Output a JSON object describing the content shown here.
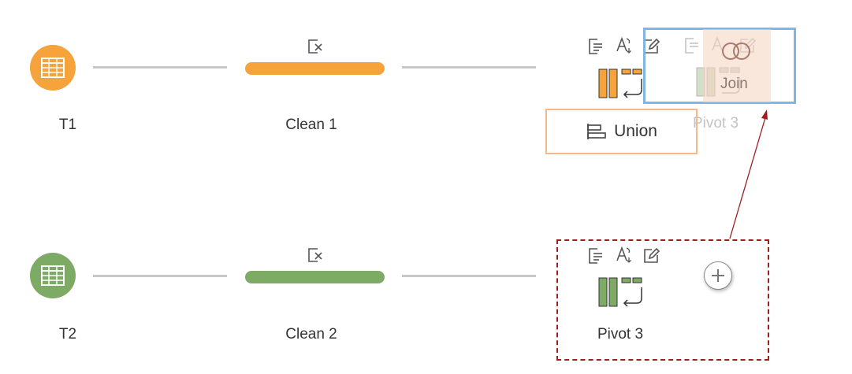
{
  "colors": {
    "flow1": "#f5a33a",
    "flow2": "#7daa64",
    "connector": "#c8c8c8",
    "drop_target": "#7fb6e6",
    "union_border": "#f5b88a",
    "selection_border": "#a01e1e"
  },
  "flow1": {
    "input_label": "T1",
    "input_icon": "table-icon",
    "clean_label": "Clean 1",
    "pivot_label": "Pivot 3"
  },
  "flow2": {
    "input_label": "T2",
    "input_icon": "table-icon",
    "clean_label": "Clean 2",
    "pivot_label": "Pivot 3"
  },
  "drop_targets": {
    "union_label": "Union",
    "join_label": "Join"
  },
  "icons": {
    "clean": "clean-step-icon",
    "filter": "filter-icon",
    "rename": "rename-field-icon",
    "edit": "edit-icon",
    "pivot": "pivot-icon",
    "add": "add-step-icon",
    "union": "union-icon",
    "join": "join-icon"
  }
}
